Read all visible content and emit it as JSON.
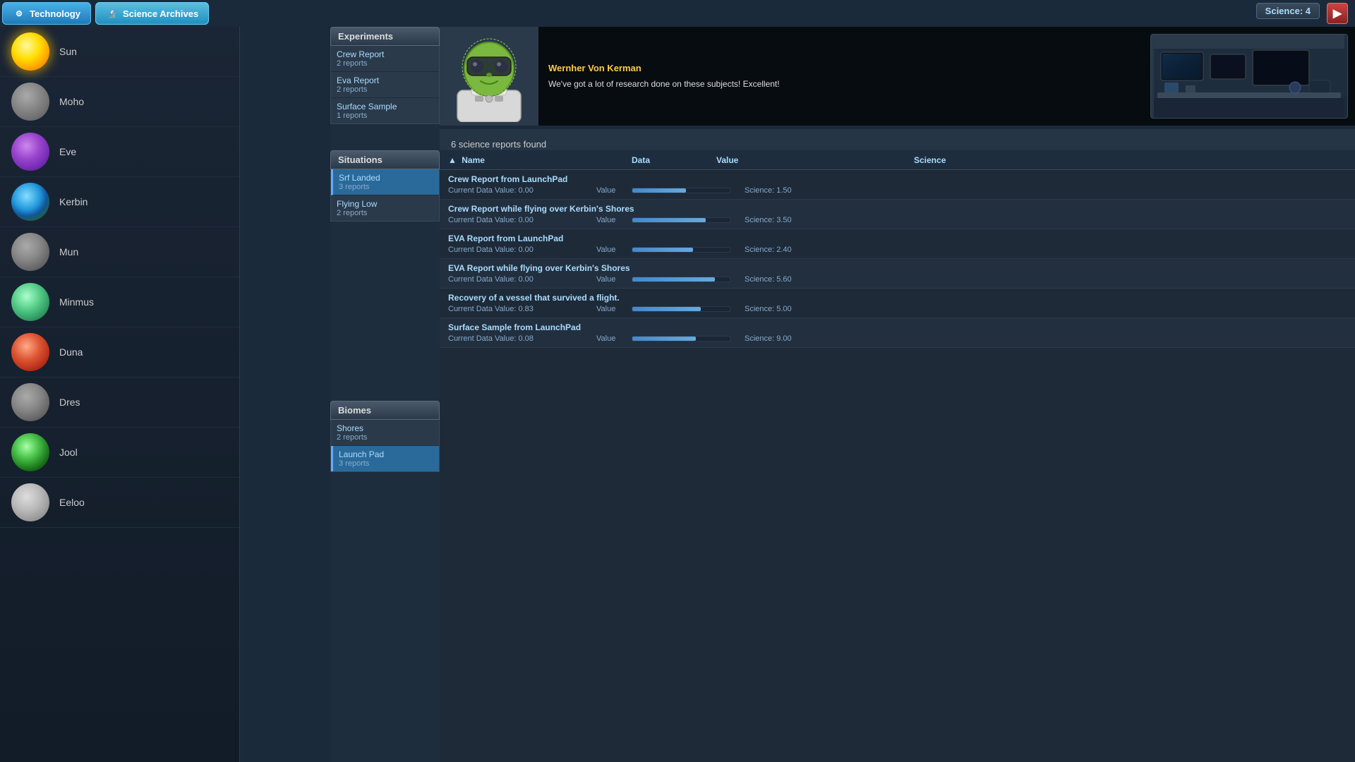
{
  "topbar": {
    "tech_label": "Technology",
    "science_label": "Science Archives",
    "science_count": "Science: 4",
    "close_label": "▶"
  },
  "character": {
    "name": "Wernher Von Kerman",
    "message": "We've got a lot of research done on these subjects! Excellent!"
  },
  "reports_found": "6 science reports found",
  "col_headers": {
    "name": "Name",
    "data": "Data",
    "value": "Value",
    "science": "Science"
  },
  "experiments": {
    "header": "Experiments",
    "items": [
      {
        "name": "Crew Report",
        "reports": "2 reports",
        "selected": false
      },
      {
        "name": "Eva Report",
        "reports": "2 reports",
        "selected": false
      },
      {
        "name": "Surface Sample",
        "reports": "1 reports",
        "selected": false
      }
    ]
  },
  "situations": {
    "header": "Situations",
    "items": [
      {
        "name": "Srf Landed",
        "reports": "3 reports",
        "selected": true
      },
      {
        "name": "Flying Low",
        "reports": "2 reports",
        "selected": false
      }
    ]
  },
  "biomes": {
    "header": "Biomes",
    "items": [
      {
        "name": "Shores",
        "reports": "2 reports",
        "selected": false
      },
      {
        "name": "Launch Pad",
        "reports": "3 reports",
        "selected": true
      }
    ]
  },
  "planets": [
    {
      "name": "Sun",
      "class": "planet-sun"
    },
    {
      "name": "Moho",
      "class": "planet-moho"
    },
    {
      "name": "Eve",
      "class": "planet-eve"
    },
    {
      "name": "Kerbin",
      "class": "planet-kerbin"
    },
    {
      "name": "Mun",
      "class": "planet-mun"
    },
    {
      "name": "Minmus",
      "class": "planet-minmus"
    },
    {
      "name": "Duna",
      "class": "planet-duna"
    },
    {
      "name": "Dres",
      "class": "planet-dres"
    },
    {
      "name": "Jool",
      "class": "planet-jool"
    },
    {
      "name": "Eeloo",
      "class": "planet-eeloo"
    }
  ],
  "reports": [
    {
      "title": "Crew Report from LaunchPad",
      "data_val": "Current Data Value: 0.00",
      "bar_pct": 55,
      "science": "Science: 1.50"
    },
    {
      "title": "Crew Report while flying over Kerbin's Shores",
      "data_val": "Current Data Value: 0.00",
      "bar_pct": 75,
      "science": "Science: 3.50"
    },
    {
      "title": "EVA Report from LaunchPad",
      "data_val": "Current Data Value: 0.00",
      "bar_pct": 62,
      "science": "Science: 2.40"
    },
    {
      "title": "EVA Report while flying over Kerbin's Shores",
      "data_val": "Current Data Value: 0.00",
      "bar_pct": 85,
      "science": "Science: 5.60"
    },
    {
      "title": "Recovery of a vessel that survived a flight.",
      "data_val": "Current Data Value: 0.83",
      "bar_pct": 70,
      "science": "Science: 5.00"
    },
    {
      "title": "Surface Sample from LaunchPad",
      "data_val": "Current Data Value: 0.08",
      "bar_pct": 65,
      "science": "Science: 9.00"
    }
  ]
}
